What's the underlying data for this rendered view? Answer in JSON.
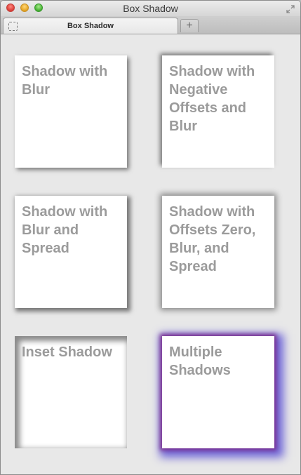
{
  "window": {
    "title": "Box Shadow"
  },
  "tabs": [
    {
      "label": "Box Shadow"
    }
  ],
  "new_tab_label": "+",
  "boxes": [
    {
      "label": "Shadow with Blur"
    },
    {
      "label": "Shadow with Negative Offsets and Blur"
    },
    {
      "label": "Shadow with Blur and Spread"
    },
    {
      "label": "Shadow with Offsets Zero, Blur, and Spread"
    },
    {
      "label": "Inset Shadow"
    },
    {
      "label": "Multiple Shadows"
    }
  ],
  "colors": {
    "box_text": "#9b9b9b",
    "page_background": "#e8e8e8",
    "multiple_shadow_inner": "#7a2f8e",
    "multiple_shadow_outer": "#6f66d8"
  }
}
